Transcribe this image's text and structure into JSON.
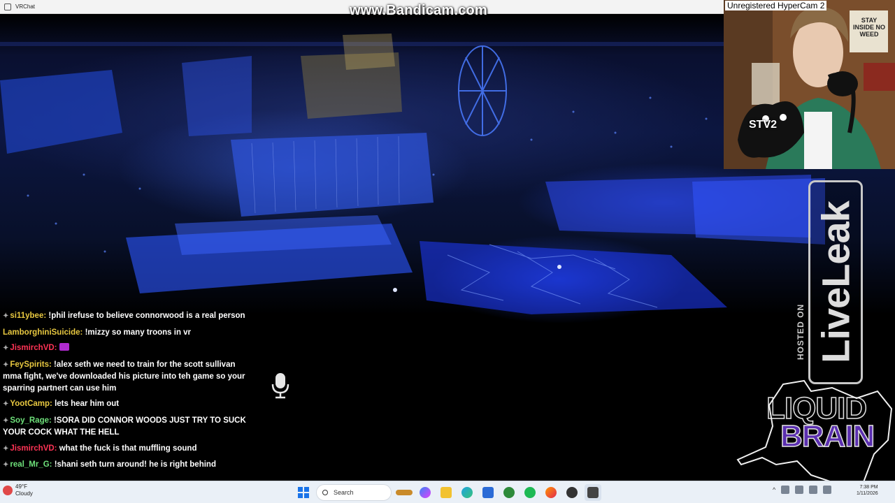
{
  "window": {
    "title": "VRChat"
  },
  "overlays": {
    "bandicam_watermark": "www.Bandicam.com",
    "hypercam_label": "Unregistered HyperCam 2",
    "stv_badge": "STV2",
    "webcam_sign": "STAY INSIDE NO WEED",
    "hosted_on": "HOSTED ON",
    "liveleak": "LiveLeak",
    "brand_line1": "LIQUID",
    "brand_line2": "BRAIN"
  },
  "chat": {
    "messages": [
      {
        "user": "si11ybee",
        "color": "u-yellow",
        "has_badge": true,
        "text": " !phil irefuse to believe connorwood is a real person"
      },
      {
        "user": "LamborghiniSuicide",
        "color": "u-yellow",
        "has_badge": false,
        "text": " !mizzy so many troons in vr"
      },
      {
        "user": "JismirchVD",
        "color": "u-red",
        "has_badge": true,
        "text": " ",
        "emote": true
      },
      {
        "user": "FeySpirits",
        "color": "u-yellow",
        "has_badge": true,
        "text": " !alex seth we need to train for the scott sullivan mma fight, we've downloaded his picture into teh game so your sparring partnert can use him"
      },
      {
        "user": "YootCamp",
        "color": "u-yellow",
        "has_badge": true,
        "text": " lets hear him out"
      },
      {
        "user": "Soy_Rage",
        "color": "u-green",
        "has_badge": true,
        "text": " !SORA DID CONNOR WOODS JUST TRY TO SUCK YOUR COCK WHAT THE HELL"
      },
      {
        "user": "JismirchVD",
        "color": "u-red",
        "has_badge": true,
        "text": " what the fuck is that muffling sound"
      },
      {
        "user": "real_Mr_G",
        "color": "u-green",
        "has_badge": true,
        "text": " !shani seth turn around! he is right behind"
      }
    ]
  },
  "taskbar": {
    "weather_temp": "49°F",
    "weather_desc": "Cloudy",
    "search_placeholder": "Search",
    "clock_time": "7:38 PM",
    "clock_date": "1/11/2026"
  },
  "colors": {
    "scene_blue": "#2a4dff",
    "taskbar_bg": "#eaf0f7",
    "brand_purple": "#5b2fb0"
  }
}
